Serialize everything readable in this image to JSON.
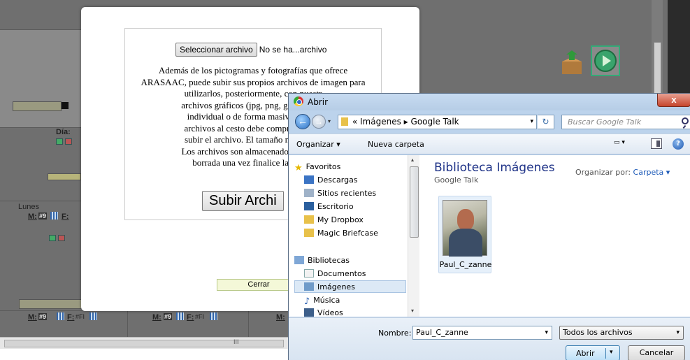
{
  "background_page": {
    "day_label": "Día:",
    "weekday_label": "Lunes",
    "row_m_label": "M:",
    "row_m_value": "#9",
    "row_f_label": "F:",
    "row_f_value": "#FI",
    "scroll_grip": "III",
    "colors": {
      "overlay": "#6f6f6f",
      "panel": "#8a8a8a",
      "play_green": "#33aa77"
    }
  },
  "upload_modal": {
    "select_file_button": "Seleccionar archivo",
    "no_file_text": "No se ha...archivo",
    "info_lines": [
      "Además de los pictogramas y fotografías que ofrece",
      "ARASAAC, puede subir sus propios archivos de imagen para",
      "utilizarlos, posteriormente, con nuestr",
      "archivos gráficos (jpg, png, gif) pueden",
      "individual o de forma masiva. Para l",
      "archivos al cesto debe comprimir las i",
      "subir el archivo. El tamaño máximo p",
      "Los archivos son almacenados en una c",
      "borrada una vez finalice la sesión"
    ],
    "upload_button": "Subir Archi",
    "close_button": "Cerrar"
  },
  "file_dialog": {
    "title": "Abrir",
    "close_glyph": "x",
    "address": {
      "prefix": "«",
      "segments": [
        "Imágenes",
        "Google Talk"
      ],
      "separator": "▸"
    },
    "search_placeholder": "Buscar Google Talk",
    "toolbar": {
      "organize": "Organizar ▾",
      "new_folder": "Nueva carpeta",
      "help": "?"
    },
    "nav": {
      "favorites_header": "Favoritos",
      "favorites": [
        "Descargas",
        "Sitios recientes",
        "Escritorio",
        "My Dropbox",
        "Magic Briefcase"
      ],
      "libraries_header": "Bibliotecas",
      "libraries": [
        "Documentos",
        "Imágenes",
        "Música",
        "Vídeos"
      ],
      "selected": "Imágenes"
    },
    "content": {
      "library_title": "Biblioteca Imágenes",
      "library_subtitle": "Google Talk",
      "arrange_label": "Organizar por:",
      "arrange_value": "Carpeta ▾",
      "files": [
        {
          "name": "Paul_C_zanne",
          "icon": "portrait-thumbnail"
        }
      ]
    },
    "bottom": {
      "name_label": "Nombre:",
      "name_value": "Paul_C_zanne",
      "file_type": "Todos los archivos",
      "open_button": "Abrir",
      "cancel_button": "Cancelar"
    },
    "colors": {
      "frame": "#bcd3ec",
      "library_title": "#1e3287",
      "close_button": "#c6452c"
    }
  }
}
